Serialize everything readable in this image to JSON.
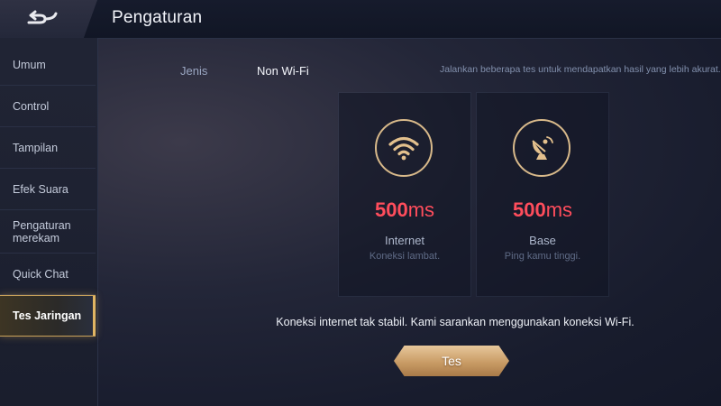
{
  "header": {
    "title": "Pengaturan",
    "back_icon": "back-arrow-icon"
  },
  "sidebar": {
    "items": [
      {
        "label": "Umum"
      },
      {
        "label": "Control"
      },
      {
        "label": "Tampilan"
      },
      {
        "label": "Efek Suara"
      },
      {
        "label": "Pengaturan merekam"
      },
      {
        "label": "Quick Chat"
      },
      {
        "label": "Tes Jaringan",
        "active": true
      }
    ]
  },
  "tabs": {
    "jenis": "Jenis",
    "non_wifi": "Non Wi-Fi"
  },
  "hint": "Jalankan beberapa tes untuk mendapatkan hasil yang lebih akurat.",
  "panels": {
    "internet": {
      "icon": "wifi-icon",
      "value": "500",
      "unit": "ms",
      "name": "Internet",
      "status": "Koneksi lambat."
    },
    "base": {
      "icon": "satellite-dish-icon",
      "value": "500",
      "unit": "ms",
      "name": "Base",
      "status": "Ping kamu tinggi."
    }
  },
  "message": "Koneksi internet tak stabil. Kami sarankan menggunakan koneksi Wi-Fi.",
  "test_button": "Tes",
  "colors": {
    "accent_gold": "#d8b98a",
    "latency_red": "#ff4d5c",
    "active_border": "#c9a25a"
  }
}
